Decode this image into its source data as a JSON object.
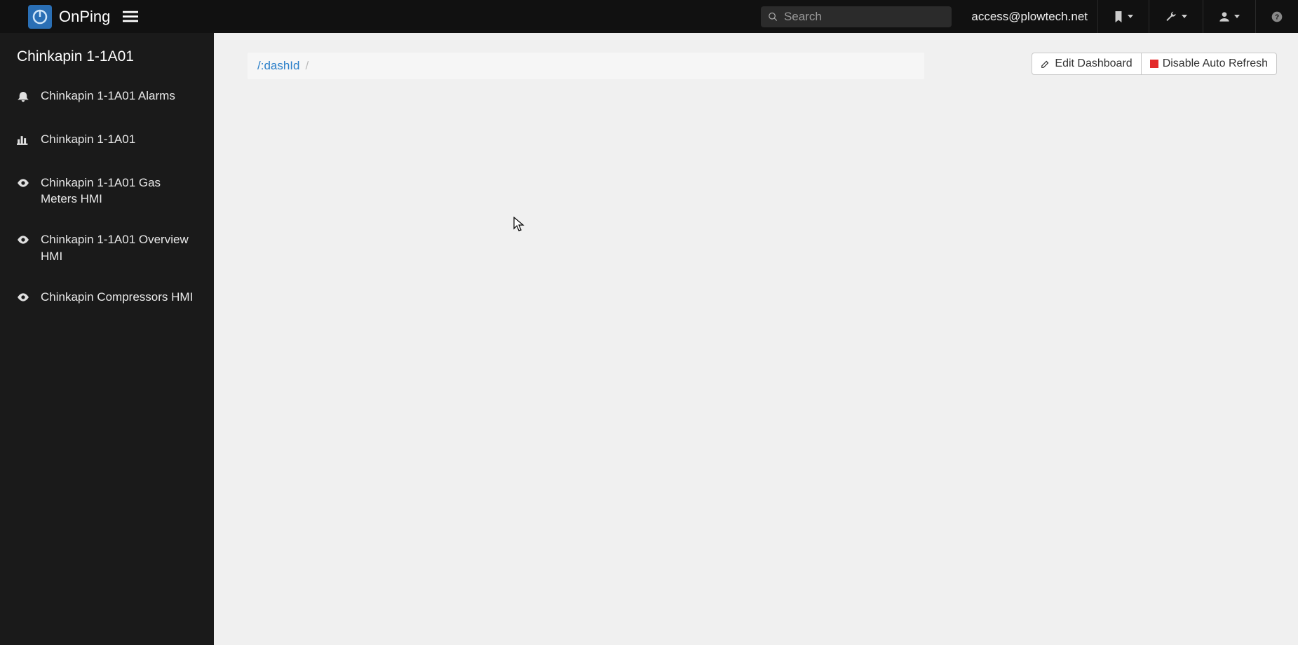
{
  "brand": {
    "name": "OnPing"
  },
  "search": {
    "placeholder": "Search"
  },
  "user": {
    "email": "access@plowtech.net"
  },
  "sidebar": {
    "title": "Chinkapin 1-1A01",
    "items": [
      {
        "icon": "bell",
        "label": "Chinkapin 1-1A01 Alarms"
      },
      {
        "icon": "bar-chart",
        "label": "Chinkapin 1-1A01"
      },
      {
        "icon": "eye",
        "label": "Chinkapin 1-1A01 Gas Meters HMI"
      },
      {
        "icon": "eye",
        "label": "Chinkapin 1-1A01 Overview HMI"
      },
      {
        "icon": "eye",
        "label": "Chinkapin Compressors HMI"
      }
    ]
  },
  "breadcrumb": {
    "link": "/:dashId",
    "sep": "/"
  },
  "toolbar": {
    "edit_label": "Edit Dashboard",
    "refresh_label": "Disable Auto Refresh"
  }
}
